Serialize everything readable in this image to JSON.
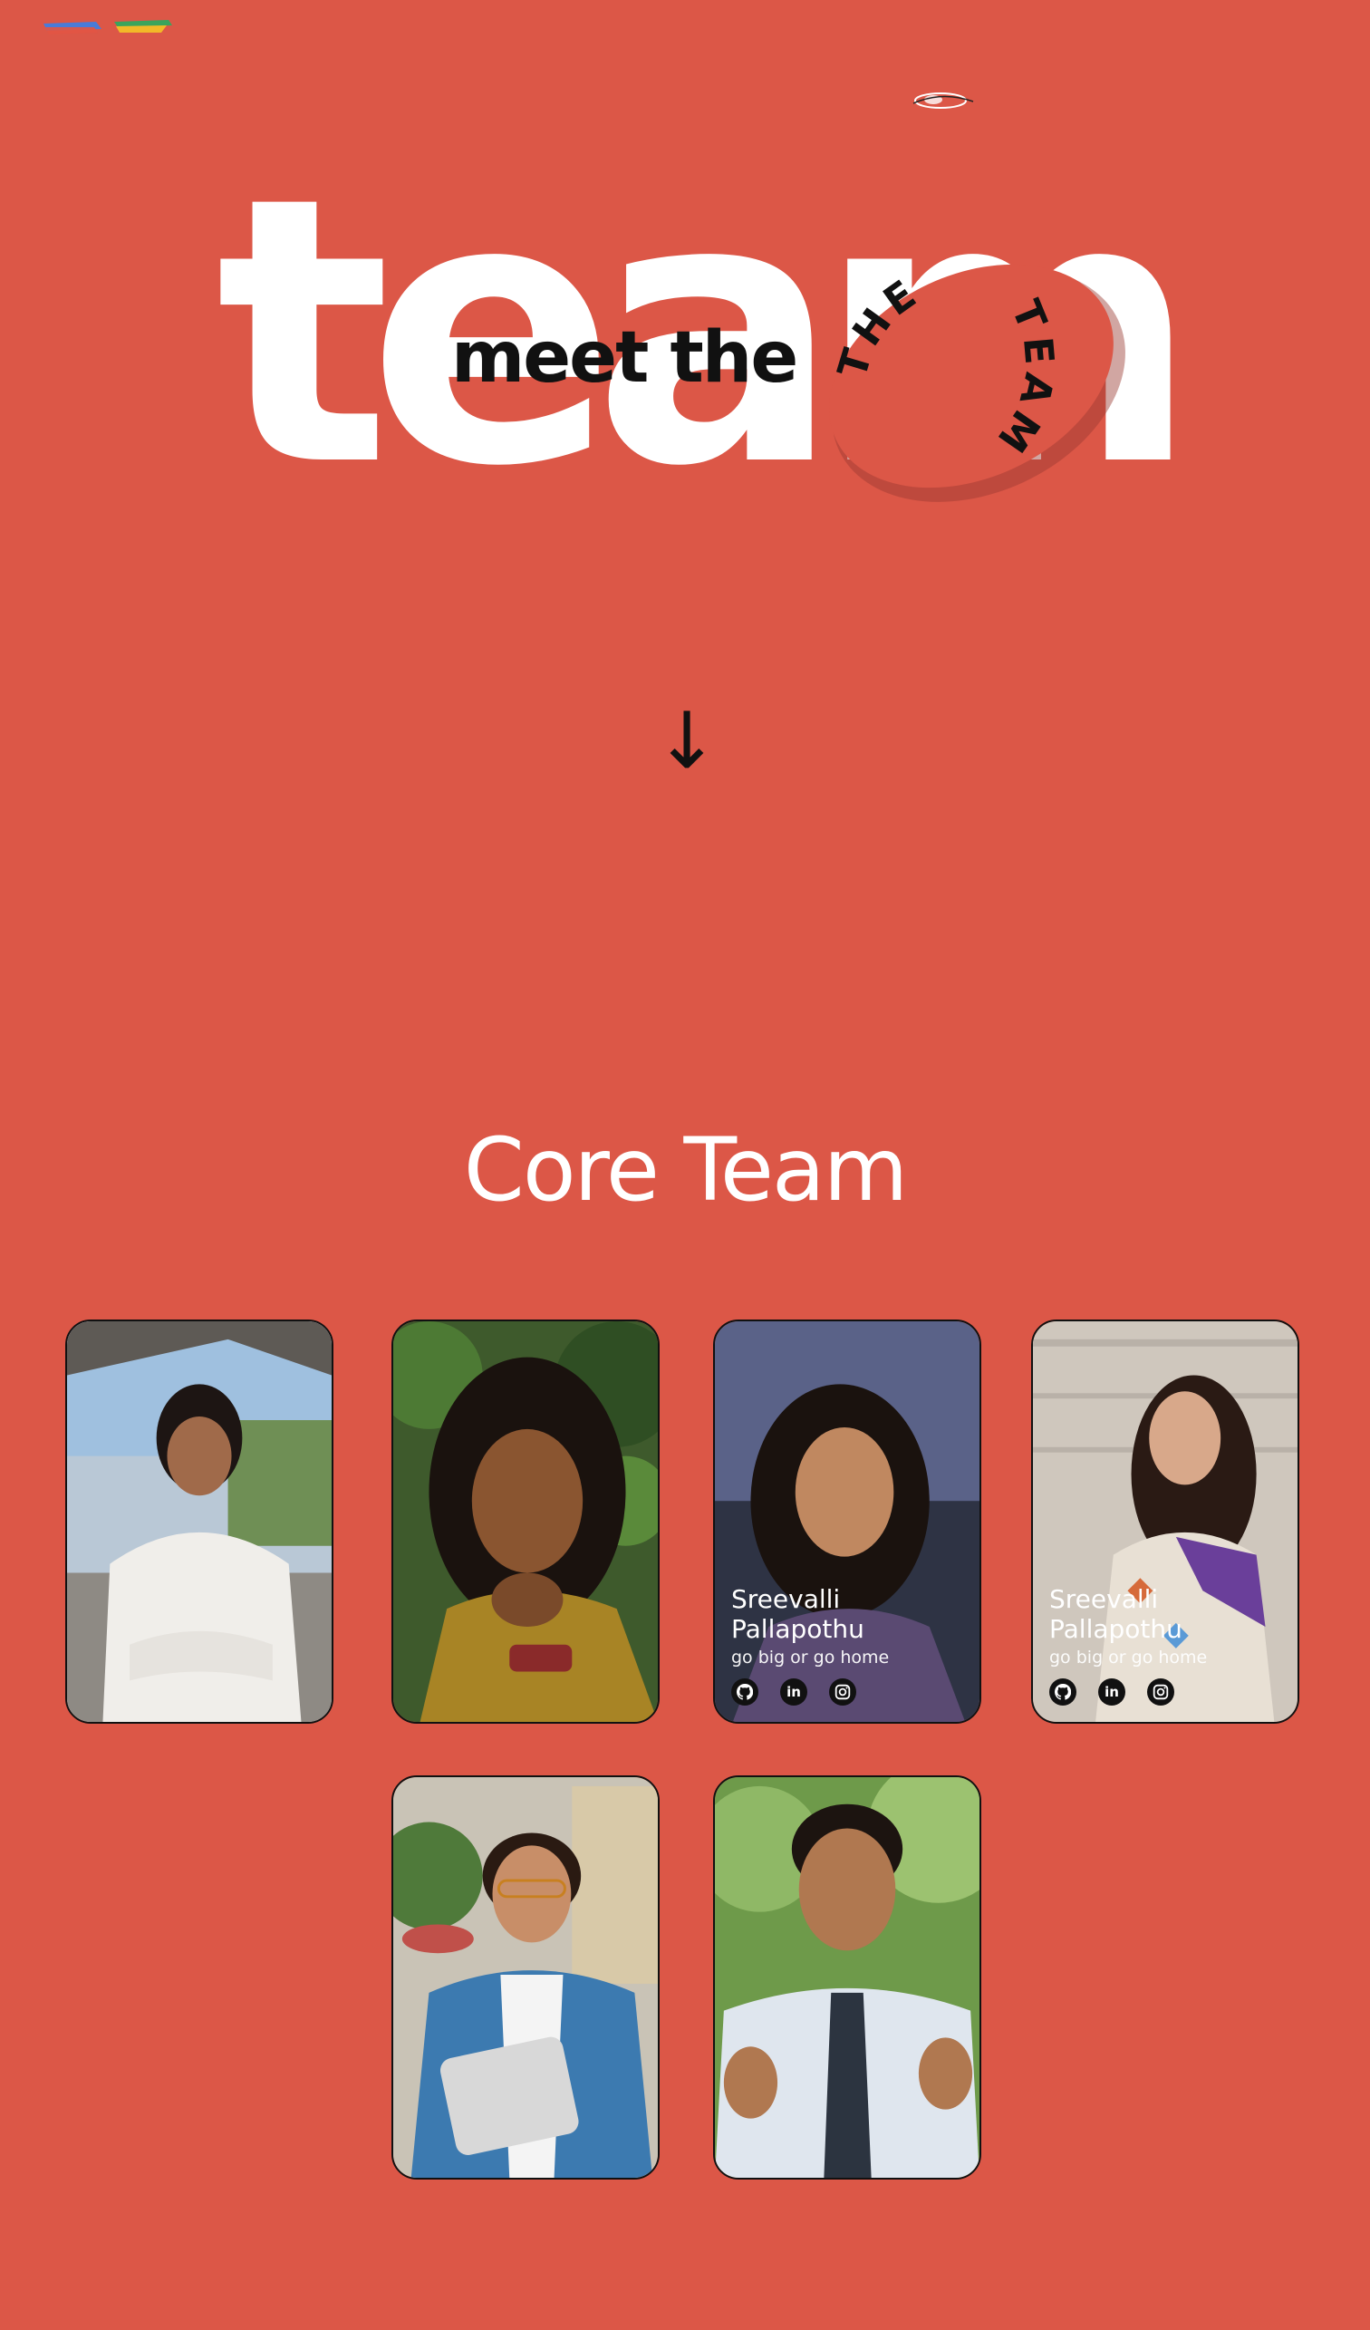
{
  "hero": {
    "big_word": "team",
    "sub_heading": "meet the",
    "badge_arc_top": "THE",
    "badge_arc_side": "TEAM",
    "scroll_arrow": "↓"
  },
  "section": {
    "title": "Core Team"
  },
  "members": [
    {
      "name": "",
      "tagline": ""
    },
    {
      "name": "",
      "tagline": ""
    },
    {
      "name_line1": "Sreevalli",
      "name_line2": "Pallapothu",
      "tagline": "go big or go home"
    },
    {
      "name_line1": "Sreevalli",
      "name_line2": "Pallapothu",
      "tagline": "go big or go home"
    },
    {
      "name": "",
      "tagline": ""
    },
    {
      "name": "",
      "tagline": ""
    }
  ],
  "social_icons": [
    "github-icon",
    "linkedin-icon",
    "instagram-icon"
  ],
  "social_labels": {
    "linkedin": "in"
  },
  "colors": {
    "background": "#dc5747",
    "text_light": "#ffffff",
    "text_dark": "#111111"
  }
}
